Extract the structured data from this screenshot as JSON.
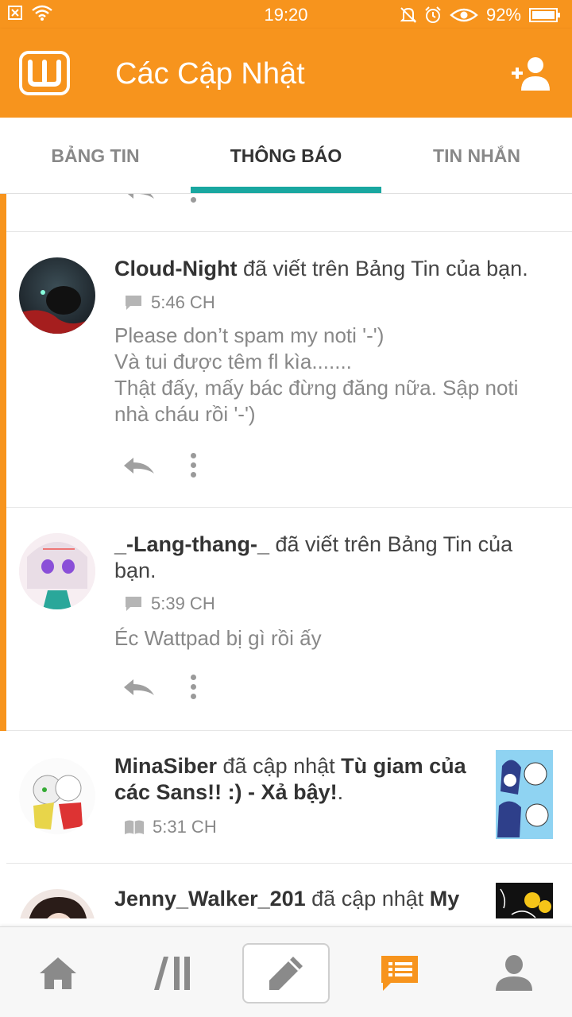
{
  "status_bar": {
    "time": "19:20",
    "battery": "92%"
  },
  "app_bar": {
    "title": "Các Cập Nhật"
  },
  "tabs": [
    {
      "label": "BẢNG TIN",
      "active": false
    },
    {
      "label": "THÔNG BÁO",
      "active": true
    },
    {
      "label": "TIN NHẮN",
      "active": false
    }
  ],
  "feed": [
    {
      "user": "Cloud-Night",
      "action": " đã viết trên Bảng Tin của bạn.",
      "time": "5:46 CH",
      "lines": [
        "Please don’t spam my noti '-')",
        "Và tui được têm fl kìa.......",
        "Thật đấy, mấy bác đừng đăng nữa. Sập noti",
        "nhà cháu rồi '-')"
      ]
    },
    {
      "user": "_-Lang-thang-_",
      "action": " đã viết trên Bảng Tin của bạn.",
      "time": "5:39 CH",
      "lines": [
        "Éc Wattpad bị gì rồi ấy"
      ]
    },
    {
      "user": "MinaSiber",
      "action": " đã cập nhật ",
      "story": "Tù giam của các Sans!! :) - Xả bậy!",
      "suffix": ".",
      "time": "5:31 CH"
    },
    {
      "user": "Jenny_Walker_201",
      "action": " đã cập nhật ",
      "story": "My"
    }
  ],
  "colors": {
    "brand": "#f7941d",
    "tab_indicator": "#19a7a0",
    "text": "#444444",
    "muted": "#888888"
  },
  "icons": {
    "status_left": [
      "close-box-icon",
      "wifi-icon"
    ],
    "status_right": [
      "bell-off-icon",
      "alarm-icon",
      "eye-icon",
      "battery-icon"
    ],
    "app_bar": [
      "wattpad-logo-icon",
      "add-user-icon"
    ],
    "bottom_nav": [
      "home-icon",
      "library-icon",
      "pencil-icon",
      "notifications-icon",
      "profile-icon"
    ]
  }
}
